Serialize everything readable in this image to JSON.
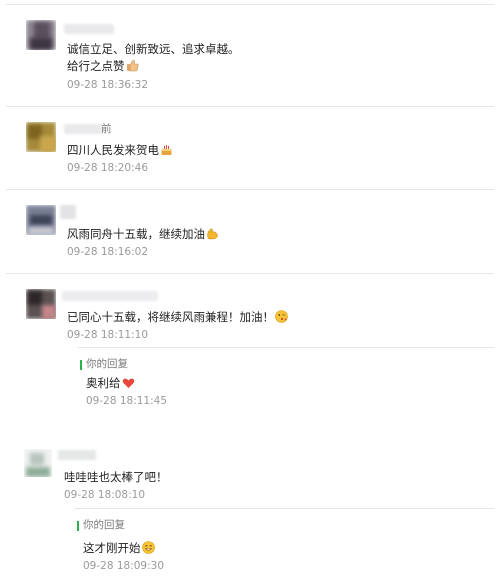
{
  "comments": [
    {
      "text": "诚信立足、创新致远、追求卓越。",
      "text_line2": "给行之点赞",
      "emoji": "thumbs-up-icon",
      "time": "09-28 18:36:32"
    },
    {
      "name_suffix": "前",
      "text": "四川人民发来贺电",
      "emoji": "cake-icon",
      "time": "09-28 18:20:46"
    },
    {
      "text": "风雨同舟十五载，继续加油",
      "emoji": "flexed-biceps-icon",
      "time": "09-28 18:16:02"
    },
    {
      "text": "已同心十五载，将继续风雨兼程！加油！",
      "emoji": "kiss-face-icon",
      "time": "09-28 18:11:10",
      "reply": {
        "label": "你的回复",
        "text": "奥利给",
        "emoji": "red-heart-icon",
        "time": "09-28 18:11:45"
      }
    },
    {
      "text": "哇哇哇也太棒了吧！",
      "time": "09-28 18:08:10",
      "reply": {
        "label": "你的回复",
        "text": "这才刚开始",
        "emoji": "grin-face-icon",
        "time": "09-28 18:09:30"
      }
    }
  ],
  "colors": {
    "reply_accent": "#2bb24c",
    "time": "#9a9a9a",
    "separator": "#e6e6e6",
    "heart": "#e8453c"
  }
}
